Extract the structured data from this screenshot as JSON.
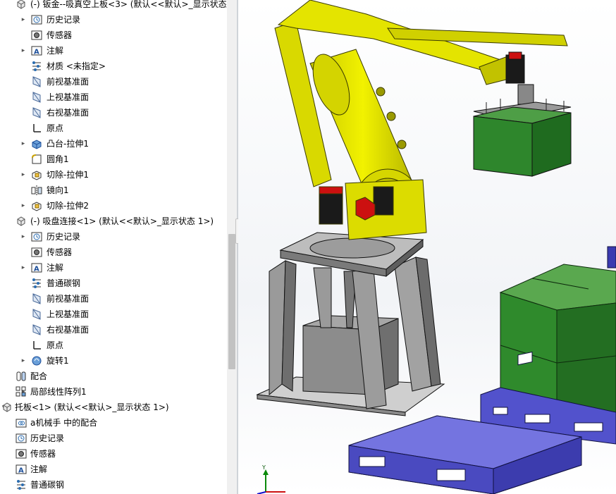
{
  "tree": {
    "rows": [
      {
        "label": "(-) 钣金--吸真空上板<3> (默认<<默认>_显示状态",
        "icon": "part-icon",
        "indent": 1,
        "arrow": "expanded"
      },
      {
        "label": "历史记录",
        "icon": "history-icon",
        "indent": 2,
        "arrow": "collapsed"
      },
      {
        "label": "传感器",
        "icon": "sensor-icon",
        "indent": 2,
        "arrow": "none"
      },
      {
        "label": "注解",
        "icon": "annotation-icon",
        "indent": 2,
        "arrow": "collapsed"
      },
      {
        "label": "材质 <未指定>",
        "icon": "material-icon",
        "indent": 2,
        "arrow": "none"
      },
      {
        "label": "前视基准面",
        "icon": "plane-icon",
        "indent": 2,
        "arrow": "none"
      },
      {
        "label": "上视基准面",
        "icon": "plane-icon",
        "indent": 2,
        "arrow": "none"
      },
      {
        "label": "右视基准面",
        "icon": "plane-icon",
        "indent": 2,
        "arrow": "none"
      },
      {
        "label": "原点",
        "icon": "origin-icon",
        "indent": 2,
        "arrow": "none"
      },
      {
        "label": "凸台-拉伸1",
        "icon": "boss-extrude-icon",
        "indent": 2,
        "arrow": "collapsed"
      },
      {
        "label": "圆角1",
        "icon": "fillet-icon",
        "indent": 2,
        "arrow": "none"
      },
      {
        "label": "切除-拉伸1",
        "icon": "cut-extrude-icon",
        "indent": 2,
        "arrow": "collapsed"
      },
      {
        "label": "镜向1",
        "icon": "mirror-icon",
        "indent": 2,
        "arrow": "none"
      },
      {
        "label": "切除-拉伸2",
        "icon": "cut-extrude-icon",
        "indent": 2,
        "arrow": "collapsed"
      },
      {
        "label": "(-) 吸盘连接<1> (默认<<默认>_显示状态 1>)",
        "icon": "part-icon",
        "indent": 1,
        "arrow": "expanded"
      },
      {
        "label": "历史记录",
        "icon": "history-icon",
        "indent": 2,
        "arrow": "collapsed"
      },
      {
        "label": "传感器",
        "icon": "sensor-icon",
        "indent": 2,
        "arrow": "none"
      },
      {
        "label": "注解",
        "icon": "annotation-icon",
        "indent": 2,
        "arrow": "collapsed"
      },
      {
        "label": "普通碳钢",
        "icon": "material-icon",
        "indent": 2,
        "arrow": "none"
      },
      {
        "label": "前视基准面",
        "icon": "plane-icon",
        "indent": 2,
        "arrow": "none"
      },
      {
        "label": "上视基准面",
        "icon": "plane-icon",
        "indent": 2,
        "arrow": "none"
      },
      {
        "label": "右视基准面",
        "icon": "plane-icon",
        "indent": 2,
        "arrow": "none"
      },
      {
        "label": "原点",
        "icon": "origin-icon",
        "indent": 2,
        "arrow": "none"
      },
      {
        "label": "旋转1",
        "icon": "revolve-icon",
        "indent": 2,
        "arrow": "collapsed"
      },
      {
        "label": "配合",
        "icon": "mates-icon",
        "indent": 1,
        "arrow": "none"
      },
      {
        "label": "局部线性阵列1",
        "icon": "pattern-icon",
        "indent": 1,
        "arrow": "collapsed"
      },
      {
        "label": "托板<1> (默认<<默认>_显示状态 1>)",
        "icon": "part-icon",
        "indent": 0,
        "arrow": "expanded"
      },
      {
        "label": "a机械手 中的配合",
        "icon": "mates-folder-icon",
        "indent": 1,
        "arrow": "collapsed"
      },
      {
        "label": "历史记录",
        "icon": "history-icon",
        "indent": 1,
        "arrow": "collapsed"
      },
      {
        "label": "传感器",
        "icon": "sensor-icon",
        "indent": 1,
        "arrow": "none"
      },
      {
        "label": "注解",
        "icon": "annotation-icon",
        "indent": 1,
        "arrow": "collapsed"
      },
      {
        "label": "普通碳钢",
        "icon": "material-icon",
        "indent": 1,
        "arrow": "none"
      }
    ]
  },
  "triad": {
    "y_label": "Y"
  },
  "colors": {
    "robot_yellow": "#e6e600",
    "robot_dark_yellow": "#a8a800",
    "cube_green": "#2e8a2e",
    "pallet_blue": "#4a4ac8",
    "frame_gray": "#9a9a9a"
  }
}
